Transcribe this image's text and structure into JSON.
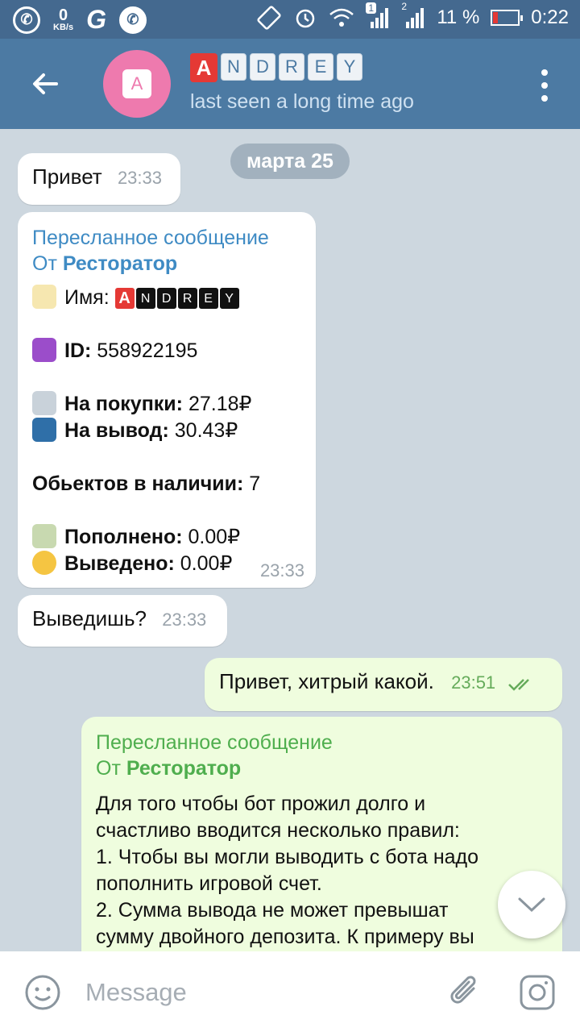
{
  "status_bar": {
    "speed_value": "0",
    "speed_unit": "KB/s",
    "g_label": "G",
    "sim1_badge": "1",
    "sim2_badge": "2",
    "battery_percent": "11 %",
    "time": "0:22"
  },
  "header": {
    "avatar_letter": "A",
    "title_tiles": [
      "A",
      "N",
      "D",
      "R",
      "E",
      "Y"
    ],
    "subtitle": "last seen a long time ago"
  },
  "chat": {
    "date_chip": "марта 25",
    "msg1": {
      "text": "Привет",
      "time": "23:33"
    },
    "msg2": {
      "fwd_title": "Пересланное сообщение",
      "fwd_from_prefix": "От",
      "fwd_from_name": "Ресторатор",
      "name_label": "Имя:",
      "name_tiles": [
        "A",
        "N",
        "D",
        "R",
        "E",
        "Y"
      ],
      "id_label": "ID:",
      "id_value": "558922195",
      "buy_label": "На покупки:",
      "buy_value": "27.18₽",
      "withdraw_label": "На вывод:",
      "withdraw_value": "30.43₽",
      "objects_label": "Обьектов в наличии:",
      "objects_value": "7",
      "topup_label": "Пополнено:",
      "topup_value": "0.00₽",
      "withdrawn_label": "Выведено:",
      "withdrawn_value": "0.00₽",
      "time": "23:33"
    },
    "msg3": {
      "text": "Выведишь?",
      "time": "23:33"
    },
    "msg4": {
      "text": "Привет, хитрый какой.",
      "time": "23:51"
    },
    "msg5": {
      "fwd_title": "Пересланное сообщение",
      "fwd_from_prefix": "От",
      "fwd_from_name": "Ресторатор",
      "lines": [
        "Для того чтобы бот прожил долго и",
        "счастливо вводится несколько правил:",
        "1. Чтобы вы могли выводить с бота надо",
        "пополнить игровой счет.",
        "2. Сумма вывода не может превышат",
        "сумму двойного депозита. К примеру вы"
      ]
    }
  },
  "input": {
    "placeholder": "Message"
  },
  "colors": {
    "header": "#4c7aa3",
    "status_bar": "#44698f",
    "outgoing_bubble": "#effdde",
    "link_blue": "#3f8bc4",
    "link_green": "#4fae4e",
    "avatar": "#ee7aae"
  }
}
